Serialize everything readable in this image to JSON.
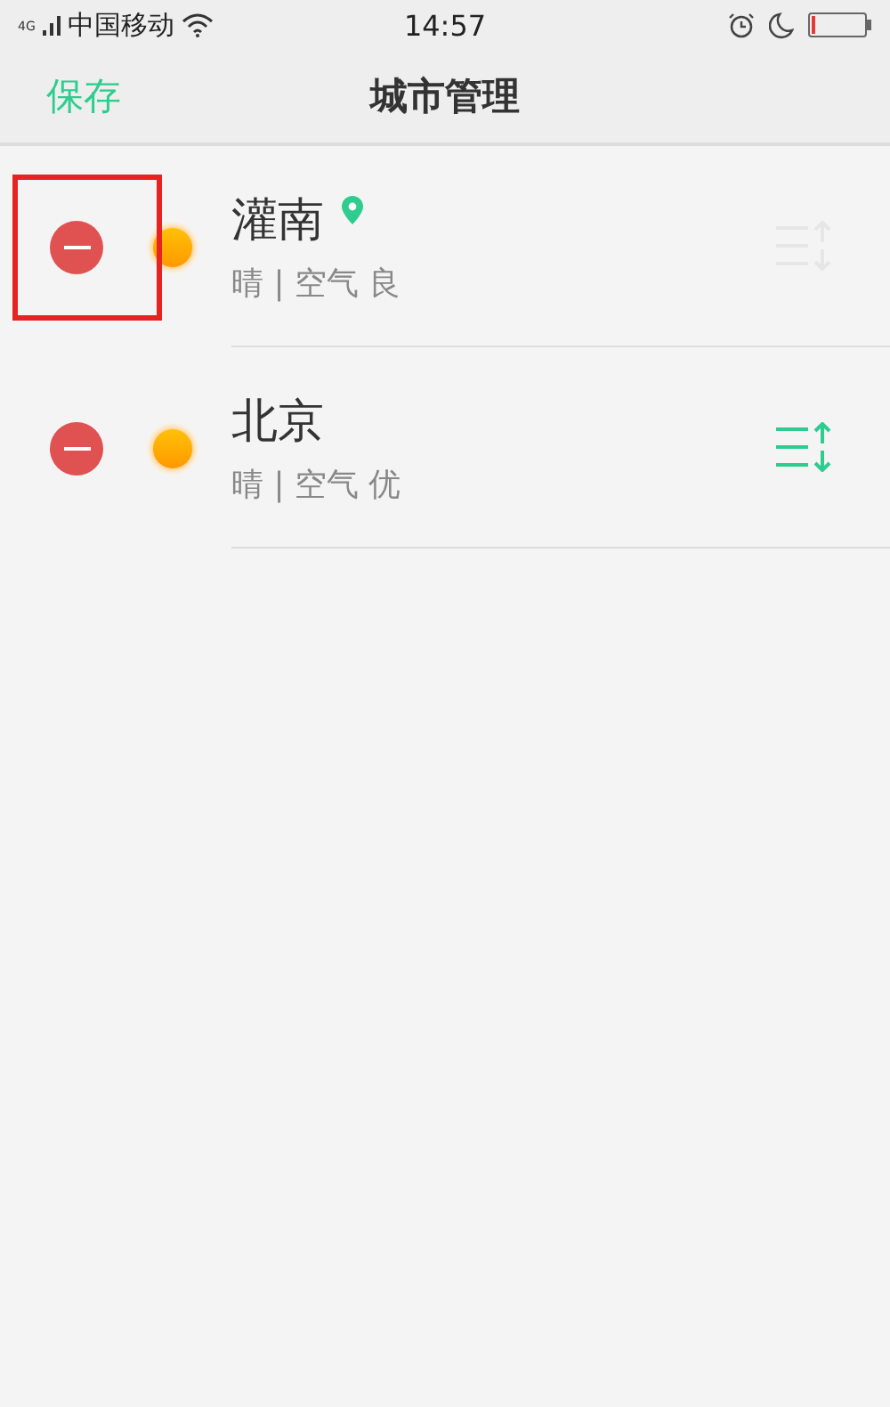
{
  "status_bar": {
    "network": "4G",
    "carrier": "中国移动",
    "time": "14:57"
  },
  "header": {
    "save": "保存",
    "title": "城市管理"
  },
  "cities": [
    {
      "name": "灌南",
      "located": true,
      "weather": "晴 | 空气 良",
      "sortable": false,
      "highlighted": true
    },
    {
      "name": "北京",
      "located": false,
      "weather": "晴 | 空气 优",
      "sortable": true,
      "highlighted": false
    }
  ]
}
